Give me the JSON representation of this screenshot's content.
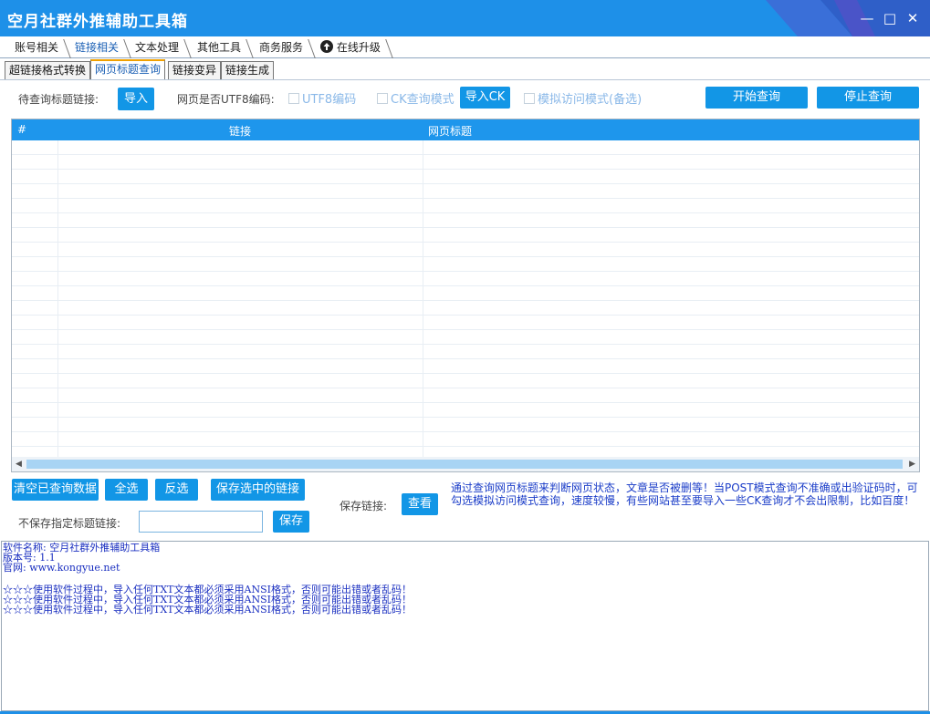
{
  "app": {
    "title": "空月社群外推辅助工具箱",
    "accent_color": "#1e90e8"
  },
  "window_controls": {
    "minimize_icon": "minimize-icon",
    "maximize_icon": "maximize-icon",
    "close_icon": "close-icon"
  },
  "main_tabs": [
    {
      "label": "账号相关"
    },
    {
      "label": "链接相关",
      "active": true
    },
    {
      "label": "文本处理"
    },
    {
      "label": "其他工具"
    },
    {
      "label": "商务服务"
    },
    {
      "label": "在线升级",
      "icon": "upload-circle-icon"
    }
  ],
  "sub_tabs": [
    {
      "label": "超链接格式转换"
    },
    {
      "label": "网页标题查询",
      "active": true
    },
    {
      "label": "链接变异"
    },
    {
      "label": "链接生成"
    }
  ],
  "toolbar": {
    "pending_label": "待查询标题链接:",
    "import_btn": "导入",
    "utf8_question": "网页是否UTF8编码:",
    "utf8_checkbox": "UTF8编码",
    "ck_mode_checkbox": "CK查询模式",
    "import_ck_btn": "导入CK",
    "simulate_checkbox": "模拟访问模式(备选)",
    "start_btn": "开始查询",
    "stop_btn": "停止查询"
  },
  "grid": {
    "columns": [
      "#",
      "链接",
      "网页标题"
    ],
    "rows": []
  },
  "actions": {
    "clear_btn": "清空已查询数据",
    "select_all_btn": "全选",
    "invert_btn": "反选",
    "save_selected_btn": "保存选中的链接",
    "save_link_label": "保存链接:",
    "view_btn": "查看",
    "exclude_label": "不保存指定标题链接:",
    "exclude_value": "",
    "save_btn": "保存"
  },
  "info_text": "通过查询网页标题来判断网页状态，文章是否被删等！当POST模式查询不准确或出验证码时，可勾选模拟访问模式查询，速度较慢，有些网站甚至要导入一些CK查询才不会出限制，比如百度！",
  "log": {
    "line1": "软件名称: 空月社群外推辅助工具箱",
    "line2": "版本号: 1.1",
    "line3": "官网: www.kongyue.net",
    "warn1": "☆☆☆使用软件过程中，导入任何TXT文本都必须采用ANSI格式，否则可能出错或者乱码！",
    "warn2": "☆☆☆使用软件过程中，导入任何TXT文本都必须采用ANSI格式，否则可能出错或者乱码！",
    "warn3": "☆☆☆使用软件过程中，导入任何TXT文本都必须采用ANSI格式，否则可能出错或者乱码！"
  }
}
